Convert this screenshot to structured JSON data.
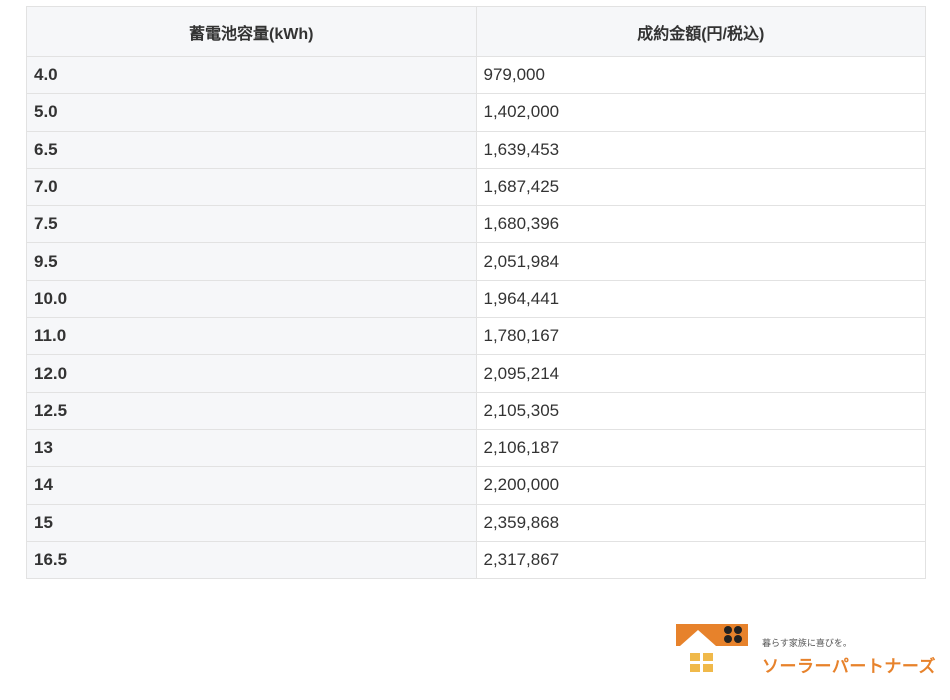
{
  "table": {
    "headers": [
      "蓄電池容量(kWh)",
      "成約金額(円/税込)"
    ],
    "rows": [
      {
        "capacity": "4.0",
        "price": "979,000"
      },
      {
        "capacity": "5.0",
        "price": "1,402,000"
      },
      {
        "capacity": "6.5",
        "price": "1,639,453"
      },
      {
        "capacity": "7.0",
        "price": "1,687,425"
      },
      {
        "capacity": "7.5",
        "price": "1,680,396"
      },
      {
        "capacity": "9.5",
        "price": "2,051,984"
      },
      {
        "capacity": "10.0",
        "price": "1,964,441"
      },
      {
        "capacity": "11.0",
        "price": "1,780,167"
      },
      {
        "capacity": "12.0",
        "price": "2,095,214"
      },
      {
        "capacity": "12.5",
        "price": "2,105,305"
      },
      {
        "capacity": "13",
        "price": "2,106,187"
      },
      {
        "capacity": "14",
        "price": "2,200,000"
      },
      {
        "capacity": "15",
        "price": "2,359,868"
      },
      {
        "capacity": "16.5",
        "price": "2,317,867"
      }
    ]
  },
  "logo": {
    "tagline": "暮らす家族に喜びを。",
    "name": "ソーラーパートナーズ",
    "colors": {
      "orange": "#e7822b",
      "window": "#f0b94a",
      "panel": "#222222"
    }
  }
}
